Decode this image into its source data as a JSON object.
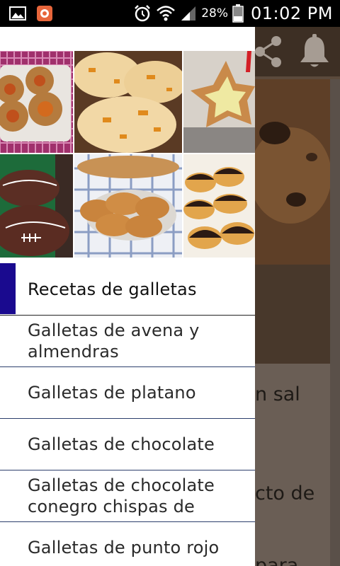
{
  "status_bar": {
    "battery_percent": "28%",
    "time": "01:02 PM",
    "icons": [
      "image-notification-icon",
      "app-notification-icon",
      "alarm-icon",
      "wifi-icon",
      "signal-icon",
      "battery-icon"
    ]
  },
  "background_app": {
    "toolbar_icons": [
      "share-icon",
      "bell-icon"
    ],
    "partial_text": [
      {
        "text": "n sal"
      },
      {
        "text": "cto de"
      },
      {
        "text": "para"
      }
    ]
  },
  "drawer": {
    "header_tiles": [
      "thumbprint-jam-cookies",
      "orange-chunk-cookies",
      "star-jam-cookie",
      "football-cookies",
      "ginger-cookies",
      "chocolate-dipped-cookies"
    ],
    "menu_items": [
      {
        "label": "Recetas de galletas",
        "active": true
      },
      {
        "label": "Galletas de avena y almendras",
        "active": false
      },
      {
        "label": "Galletas de platano",
        "active": false
      },
      {
        "label": "Galletas de chocolate",
        "active": false
      },
      {
        "label": "Galletas de chocolate conegro chispas de",
        "active": false
      },
      {
        "label": "Galletas de punto rojo",
        "active": false
      }
    ]
  },
  "colors": {
    "active_indicator": "#1a0a8f",
    "divider": "#2c3e6c",
    "scrim_toolbar": "#3d2f24"
  }
}
